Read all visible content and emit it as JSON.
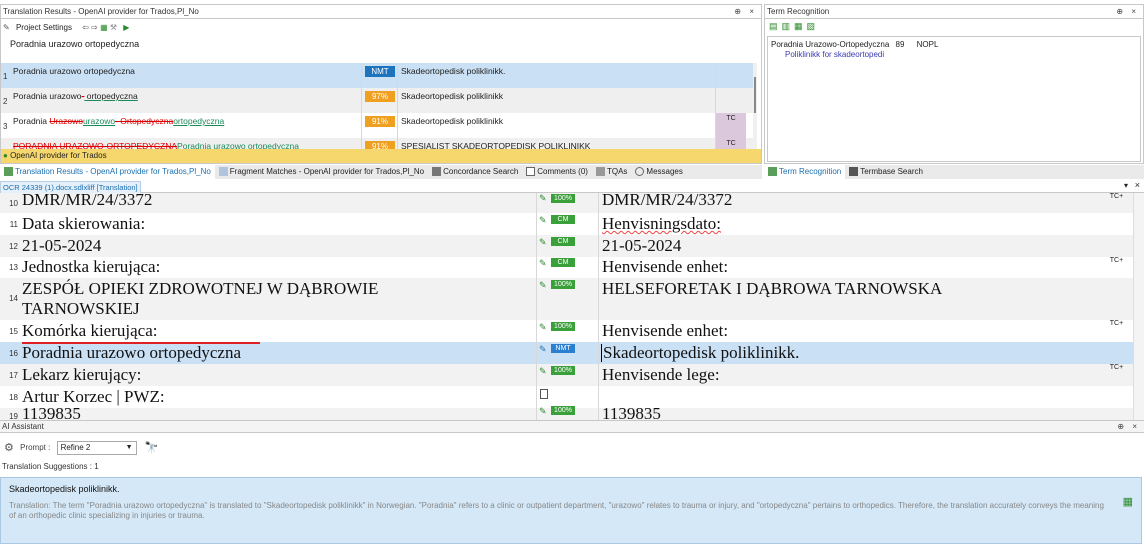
{
  "translation_results": {
    "title": "Translation Results - OpenAI provider for Trados,Pl_No",
    "toolbar": {
      "project_settings": "Project Settings"
    },
    "source_segment": "Poradnia urazowo ortopedyczna",
    "rows": [
      {
        "num": "1",
        "source": "Poradnia urazowo ortopedyczna",
        "badge": "NMT",
        "target": "Skadeortopedisk poliklinikk.",
        "tc": ""
      },
      {
        "num": "2",
        "source_a": "Poradnia urazowo",
        "source_del": "-",
        "source_b": " ortopedyczna",
        "badge": "97%",
        "target": "Skadeortopedisk poliklinikk",
        "tc": ""
      },
      {
        "num": "3",
        "source_a": "Poradnia ",
        "source_del1": "Urazowo",
        "source_ins1": "urazowo",
        "source_del2": "- Ortopedyczna",
        "source_ins2": "ortopedyczna",
        "badge": "91%",
        "target": "Skadeortopedisk poliklinikk",
        "tc": "TC"
      },
      {
        "num": "",
        "source_del": "PORADNIA URAZOWO-ORTOPEDYCZNA",
        "source_ins": "Poradnia urazowo ortopedyczna",
        "badge": "91%",
        "target": "SPESIALIST SKADEORTOPEDISK POLIKLINIKK",
        "tc": "TC"
      }
    ],
    "status": "OpenAI provider for Trados"
  },
  "term_recognition": {
    "title": "Term Recognition",
    "source_term": "Poradnia Urazowo-Ortopedyczna",
    "score": "89",
    "code": "NOPL",
    "target_term": "Poliklinikk for skadeortopedi"
  },
  "tabs_left": [
    "Translation Results - OpenAI provider for Trados,Pl_No",
    "Fragment Matches - OpenAI provider for Trados,Pl_No",
    "Concordance Search",
    "Comments (0)",
    "TQAs",
    "Messages"
  ],
  "tabs_right": [
    "Term Recognition",
    "Termbase Search"
  ],
  "editor": {
    "doc_tab": "OCR 24339 (1).docx.sdlxliff [Translation]",
    "rows": [
      {
        "num": "10",
        "source": "DMR/MR/24/3372",
        "status": "100%",
        "target": "DMR/MR/24/3372",
        "tc": "TC+"
      },
      {
        "num": "11",
        "source": "Data skierowania:",
        "status": "CM",
        "target": "Henvisningsdato:",
        "tc": ""
      },
      {
        "num": "12",
        "source": "21-05-2024",
        "status": "CM",
        "target": "21-05-2024",
        "tc": ""
      },
      {
        "num": "13",
        "source": "Jednostka kierująca:",
        "status": "CM",
        "target": "Henvisende enhet:",
        "tc": "TC+"
      },
      {
        "num": "14",
        "source": "ZESPÓŁ OPIEKI ZDROWOTNEJ W DĄBROWIE TARNOWSKIEJ",
        "status": "100%",
        "target": "HELSEFORETAK I DĄBROWA TARNOWSKA",
        "tc": ""
      },
      {
        "num": "15",
        "source": "Komórka kierująca:",
        "status": "100%",
        "target": "Henvisende enhet:",
        "tc": "TC+"
      },
      {
        "num": "16",
        "source": "Poradnia urazowo ortopedyczna",
        "status": "NMT",
        "target": "Skadeortopedisk poliklinikk.",
        "tc": ""
      },
      {
        "num": "17",
        "source": "Lekarz kierujący:",
        "status": "100%",
        "target": "Henvisende lege:",
        "tc": "TC+"
      },
      {
        "num": "18",
        "source": "Artur Korzec | PWZ:",
        "status": "",
        "target": "",
        "tc": ""
      },
      {
        "num": "19",
        "source": "1139835",
        "status": "100%",
        "target": "1139835",
        "tc": ""
      }
    ]
  },
  "ai_assistant": {
    "title": "AI Assistant",
    "prompt_label": "Prompt :",
    "prompt_value": "Refine 2",
    "suggestions_label": "Translation Suggestions : 1",
    "suggestion": "Skadeortopedisk poliklinikk.",
    "explanation": "Translation: The term \"Poradnia urazowo ortopedyczna\" is translated to \"Skadeortopedisk poliklinikk\" in Norwegian. \"Poradnia\" refers to a clinic or outpatient department, \"urazowo\" relates to trauma or injury, and \"ortopedyczna\" pertains to orthopedics. Therefore, the translation accurately conveys the meaning of an orthopedic clinic specializing in injuries or trauma."
  },
  "colors": {
    "selected_row": "#c9e0f5",
    "tc_column": "#dcc8dc",
    "nmt": "#1e73be",
    "fuzzy": "#f0a020",
    "cm": "#3aa03a",
    "status_bar": "#f5d76e"
  }
}
